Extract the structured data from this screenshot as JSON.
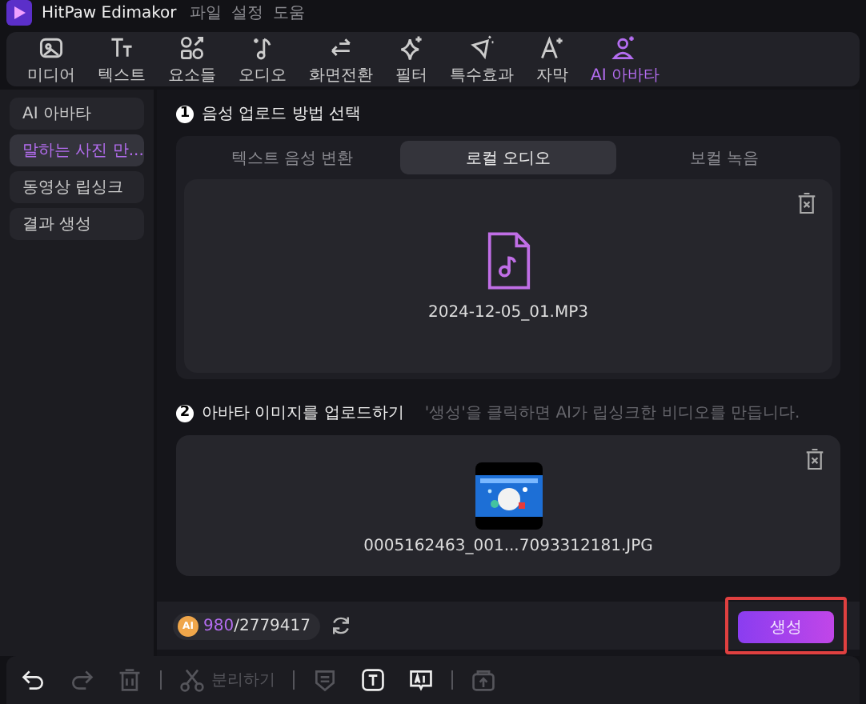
{
  "app": {
    "title": "HitPaw Edimakor",
    "menu": [
      "파일",
      "설정",
      "도움"
    ]
  },
  "toolbar": [
    {
      "label": "미디어",
      "selected": false
    },
    {
      "label": "텍스트",
      "selected": false
    },
    {
      "label": "요소들",
      "selected": false
    },
    {
      "label": "오디오",
      "selected": false
    },
    {
      "label": "화면전환",
      "selected": false
    },
    {
      "label": "필터",
      "selected": false
    },
    {
      "label": "특수효과",
      "selected": false
    },
    {
      "label": "자막",
      "selected": false
    },
    {
      "label": "AI 아바타",
      "selected": true
    }
  ],
  "sidebar": [
    {
      "label": "AI 아바타",
      "selected": false
    },
    {
      "label": "말하는 사진 만...",
      "selected": true
    },
    {
      "label": "동영상 립싱크",
      "selected": false
    },
    {
      "label": "결과 생성",
      "selected": false
    }
  ],
  "step1": {
    "number": "1",
    "title": "음성 업로드 방법 선택",
    "tabs": [
      {
        "label": "텍스트 음성 변환",
        "selected": false
      },
      {
        "label": "로컬 오디오",
        "selected": true
      },
      {
        "label": "보컬 녹음",
        "selected": false
      }
    ],
    "file_name": "2024-12-05_01.MP3"
  },
  "step2": {
    "number": "2",
    "title": "아바타 이미지를 업로드하기",
    "hint": "'생성'을 클릭하면 AI가 립싱크한 비디오를 만듭니다.",
    "file_name": "0005162463_001...7093312181.JPG"
  },
  "footer": {
    "credit_badge": "AI",
    "credits_used": "980",
    "credits_total": "/2779417",
    "generate_button": {
      "label": "생성",
      "highlighted": true
    }
  },
  "bottom_tools": [
    {
      "kind": "button",
      "disabled": false
    },
    {
      "kind": "button",
      "disabled": true
    },
    {
      "kind": "button",
      "disabled": true
    },
    {
      "kind": "separator"
    },
    {
      "kind": "button",
      "disabled": true,
      "label": "분리하기"
    },
    {
      "kind": "separator"
    },
    {
      "kind": "button",
      "disabled": true
    },
    {
      "kind": "button",
      "disabled": false
    },
    {
      "kind": "button",
      "disabled": false
    },
    {
      "kind": "separator"
    },
    {
      "kind": "button",
      "disabled": true
    }
  ]
}
